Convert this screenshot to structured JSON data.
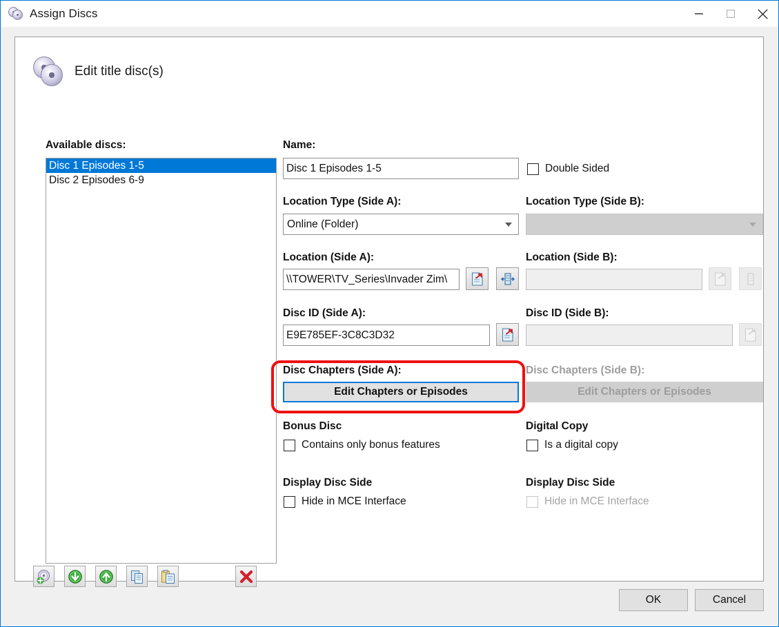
{
  "window": {
    "title": "Assign Discs",
    "icon": "discs-icon",
    "controls": {
      "minimize": "minimize-icon",
      "maximize": "maximize-icon",
      "close": "close-icon"
    }
  },
  "page": {
    "heading": "Edit title disc(s)",
    "heading_icon": "discs-icon"
  },
  "available_discs": {
    "label": "Available discs:",
    "items": [
      {
        "name": "Disc 1 Episodes 1-5",
        "selected": true
      },
      {
        "name": "Disc 2 Episodes 6-9",
        "selected": false
      }
    ]
  },
  "toolbar": {
    "add_disc": "add-disc-icon",
    "move_down": "move-down-icon",
    "move_up": "move-up-icon",
    "copy": "copy-icon",
    "paste": "paste-icon",
    "delete": "delete-icon"
  },
  "form": {
    "name": {
      "label": "Name:",
      "value": "Disc 1 Episodes 1-5"
    },
    "double_sided": {
      "label": "Double Sided",
      "checked": false
    },
    "location_type_a": {
      "label": "Location Type (Side A):",
      "value": "Online (Folder)",
      "enabled": true
    },
    "location_type_b": {
      "label": "Location Type (Side B):",
      "value": "",
      "enabled": false
    },
    "location_a": {
      "label": "Location (Side A):",
      "value": "\\\\TOWER\\TV_Series\\Invader Zim\\",
      "enabled": true,
      "browse_icon": "browse-folder-icon",
      "media_icon": "media-device-icon"
    },
    "location_b": {
      "label": "Location (Side B):",
      "value": "",
      "enabled": false,
      "browse_icon": "browse-folder-icon",
      "media_icon": "media-device-icon"
    },
    "disc_id_a": {
      "label": "Disc ID (Side A):",
      "value": "E9E785EF-3C8C3D32",
      "enabled": true,
      "browse_icon": "browse-folder-icon"
    },
    "disc_id_b": {
      "label": "Disc ID (Side B):",
      "value": "",
      "enabled": false,
      "browse_icon": "browse-folder-icon"
    },
    "disc_chapters_a": {
      "label": "Disc Chapters (Side A):",
      "button": "Edit Chapters or Episodes",
      "enabled": true,
      "focused": true,
      "highlighted": true
    },
    "disc_chapters_b": {
      "label": "Disc Chapters (Side B):",
      "button": "Edit Chapters or Episodes",
      "enabled": false
    },
    "bonus_disc": {
      "label": "Bonus Disc",
      "checkbox": "Contains only bonus features",
      "checked": false
    },
    "digital_copy": {
      "label": "Digital Copy",
      "checkbox": "Is a digital copy",
      "checked": false
    },
    "display_disc_side_a": {
      "label": "Display Disc Side",
      "checkbox": "Hide in MCE Interface",
      "checked": false,
      "enabled": true
    },
    "display_disc_side_b": {
      "label": "Display Disc Side",
      "checkbox": "Hide in MCE Interface",
      "checked": false,
      "enabled": false
    }
  },
  "footer": {
    "ok": "OK",
    "cancel": "Cancel"
  },
  "colors": {
    "accent": "#0078d7",
    "annotation": "#ee1111",
    "window_bg": "#f0f0f0",
    "panel_bg": "#ffffff"
  }
}
